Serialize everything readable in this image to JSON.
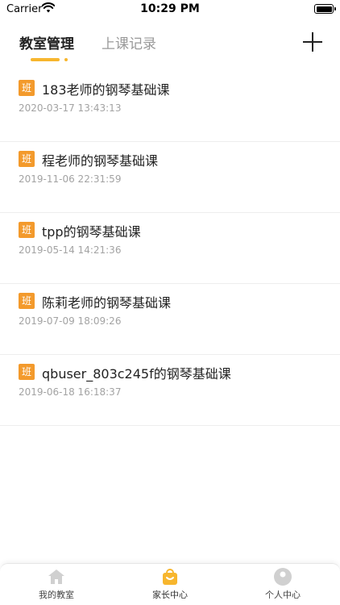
{
  "status_bar": {
    "carrier": "Carrier",
    "time": "10:29 PM"
  },
  "top_nav": {
    "tabs": [
      {
        "label": "教室管理"
      },
      {
        "label": "上课记录"
      }
    ]
  },
  "courses": [
    {
      "badge": "班",
      "title": "183老师的钢琴基础课",
      "time": "2020-03-17 13:43:13"
    },
    {
      "badge": "班",
      "title": "程老师的钢琴基础课",
      "time": "2019-11-06 22:31:59"
    },
    {
      "badge": "班",
      "title": "tpp的钢琴基础课",
      "time": "2019-05-14 14:21:36"
    },
    {
      "badge": "班",
      "title": "陈莉老师的钢琴基础课",
      "time": "2019-07-09 18:09:26"
    },
    {
      "badge": "班",
      "title": "qbuser_803c245f的钢琴基础课",
      "time": "2019-06-18 16:18:37"
    }
  ],
  "tab_bar": {
    "items": [
      {
        "label": "我的教室",
        "icon": "home-icon"
      },
      {
        "label": "家长中心",
        "icon": "shopping-bag-icon"
      },
      {
        "label": "个人中心",
        "icon": "person-icon"
      }
    ]
  },
  "colors": {
    "accent": "#f7b62e",
    "badge": "#f39a2c",
    "inactive_icon": "#d0d0d0"
  }
}
